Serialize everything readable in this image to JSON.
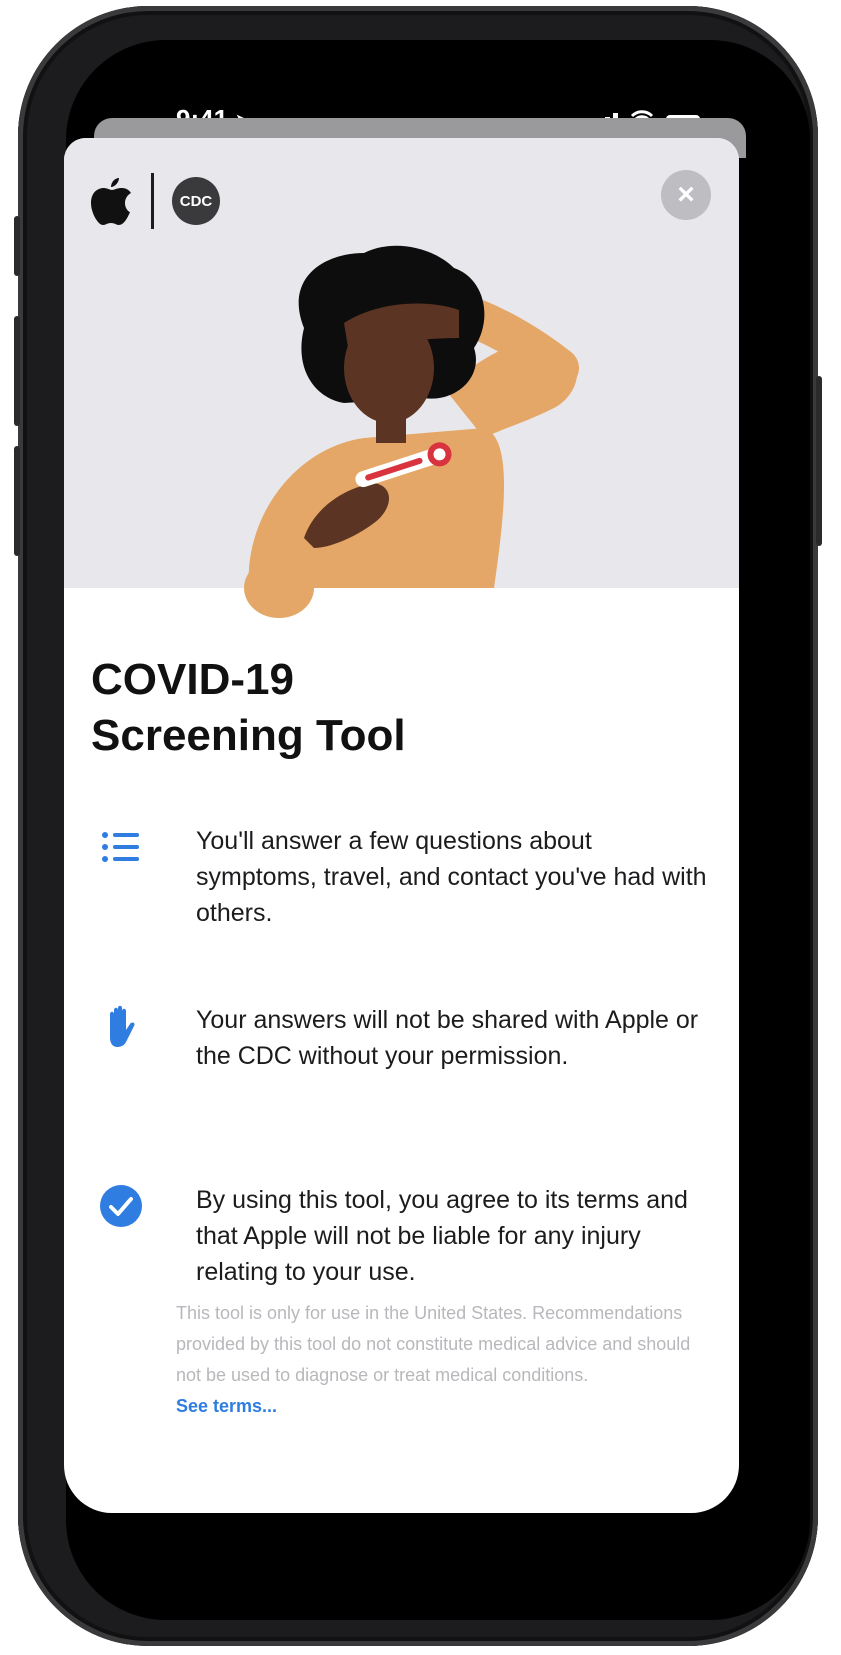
{
  "status_bar": {
    "time": "9:41"
  },
  "header": {
    "close_label": "×",
    "cdc_label": "CDC"
  },
  "title_line1": "COVID-19",
  "title_line2": "Screening Tool",
  "items": [
    {
      "icon": "list-icon",
      "text": "You'll answer a few questions about symptoms, travel, and contact you've had with others."
    },
    {
      "icon": "hand-icon",
      "text": "Your answers will not be shared with Apple or the CDC without your permission."
    },
    {
      "icon": "checkmark-icon",
      "text": "By using this tool, you agree to its terms and that Apple will not be liable for any injury relating to your use."
    }
  ],
  "fine_print": "This tool is only for use in the United States. Recommendations provided by this tool do not constitute medical advice and should not be used to diagnose or treat medical conditions.",
  "see_terms": "See terms...",
  "colors": {
    "accent": "#2f7de1",
    "hero_bg": "#e8e8ec",
    "skin": "#e4a767",
    "dark_skin": "#5b3423"
  }
}
